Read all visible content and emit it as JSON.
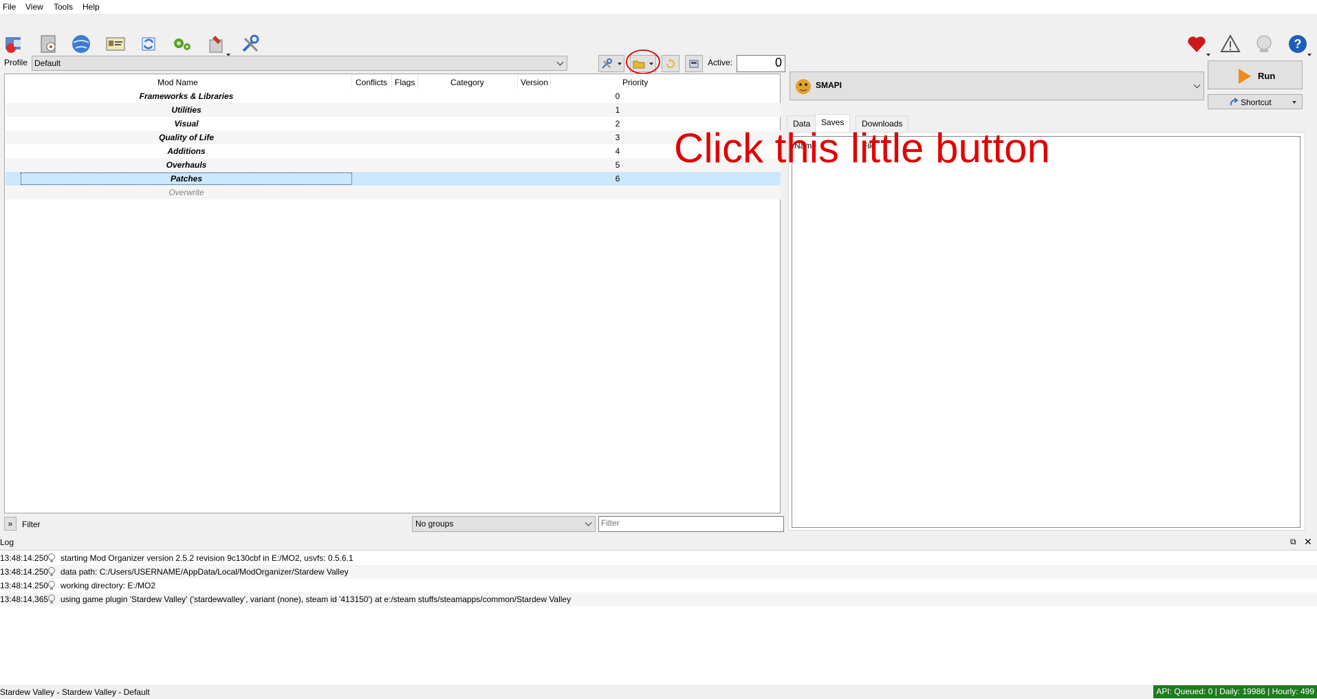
{
  "menu": [
    "File",
    "View",
    "Tools",
    "Help"
  ],
  "toolbar": {
    "left_icons": [
      "instance-manager-icon",
      "install-mod-icon",
      "nexus-globe-icon",
      "profiles-icon",
      "refresh-icon",
      "executables-icon",
      "tools-icon",
      "settings-icon"
    ],
    "right_icons": [
      "endorse-heart-icon",
      "problems-warning-icon",
      "update-icon",
      "help-icon"
    ]
  },
  "profile": {
    "label": "Profile",
    "value": "Default",
    "active_label": "Active:",
    "active_value": "0"
  },
  "modlist": {
    "columns": [
      "Mod Name",
      "Conflicts",
      "Flags",
      "Category",
      "Version",
      "Priority"
    ],
    "rows": [
      {
        "name": "Frameworks & Libraries",
        "priority": "0"
      },
      {
        "name": "Utilities",
        "priority": "1"
      },
      {
        "name": "Visual",
        "priority": "2"
      },
      {
        "name": "Quality of Life",
        "priority": "3"
      },
      {
        "name": "Additions",
        "priority": "4"
      },
      {
        "name": "Overhauls",
        "priority": "5"
      },
      {
        "name": "Patches",
        "priority": "6"
      },
      {
        "name": "Overwrite",
        "priority": ""
      }
    ]
  },
  "filter": {
    "toggle": "»",
    "label": "Filter",
    "groups_value": "No groups",
    "placeholder": "Filter"
  },
  "executable": {
    "name": "SMAPI",
    "run_label": "Run",
    "shortcut_label": "Shortcut"
  },
  "tabs": [
    "Data",
    "Saves",
    "Downloads"
  ],
  "saves_columns": [
    "Name",
    "File"
  ],
  "log": {
    "title": "Log",
    "entries": [
      {
        "time": "13:48:14.250",
        "msg": "starting Mod Organizer version 2.5.2 revision 9c130cbf in E:/MO2, usvfs: 0.5.6.1"
      },
      {
        "time": "13:48:14.250",
        "msg": "data path: C:/Users/USERNAME/AppData/Local/ModOrganizer/Stardew Valley"
      },
      {
        "time": "13:48:14.250",
        "msg": "working directory: E:/MO2"
      },
      {
        "time": "13:48:14.365",
        "msg": "using game plugin 'Stardew Valley' ('stardewvalley', variant (none), steam id '413150') at e:/steam stuffs/steamapps/common/Stardew Valley"
      }
    ]
  },
  "statusbar": {
    "text": "Stardew Valley - Stardew Valley - Default",
    "api": "API: Queued: 0 | Daily: 19986 | Hourly: 499"
  },
  "annotation": {
    "text": "Click this little button",
    "color": "#e00000"
  }
}
